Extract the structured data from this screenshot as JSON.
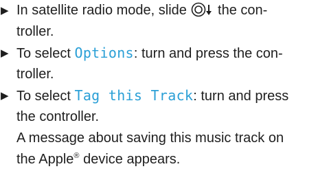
{
  "steps": [
    {
      "marker": "▶",
      "lines": {
        "l1_before": "In satellite radio mode, slide ",
        "l1_after": " the con-",
        "l2": "troller."
      },
      "icon": "controller-slide-down-icon"
    },
    {
      "marker": "▶",
      "lines": {
        "l1_before": "To select ",
        "l1_ui": "Options",
        "l1_after": ": turn and press the con-",
        "l2": "troller."
      }
    },
    {
      "marker": "▶",
      "lines": {
        "l1_before": "To select ",
        "l1_ui": "Tag this Track",
        "l1_after": ": turn and press",
        "l2": "the controller."
      }
    }
  ],
  "result": {
    "l1": "A message about saving this music track on",
    "l2_before": "the Apple",
    "l2_sup": "®",
    "l2_after": " device appears."
  }
}
